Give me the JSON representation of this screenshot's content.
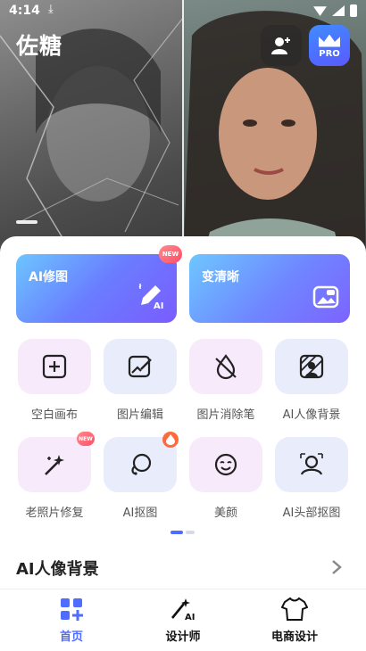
{
  "status": {
    "time": "4:14",
    "download_glyph": "⤓"
  },
  "header": {
    "brand": "佐糖",
    "pro_label": "PRO"
  },
  "feature_cards": [
    {
      "label": "AI修图",
      "badge": "NEW"
    },
    {
      "label": "变清晰"
    }
  ],
  "tools": [
    {
      "label": "空白画布"
    },
    {
      "label": "图片编辑"
    },
    {
      "label": "图片消除笔"
    },
    {
      "label": "AI人像背景"
    },
    {
      "label": "老照片修复",
      "badge": "NEW"
    },
    {
      "label": "AI抠图"
    },
    {
      "label": "美颜"
    },
    {
      "label": "AI头部抠图"
    }
  ],
  "section": {
    "title": "AI人像背景"
  },
  "nav": [
    {
      "label": "首页",
      "active": true
    },
    {
      "label": "设计师"
    },
    {
      "label": "电商设计"
    }
  ],
  "colors": {
    "accent": "#4f6cff",
    "tile_pink": "#f7eafb",
    "tile_blue": "#e9ecfb"
  }
}
